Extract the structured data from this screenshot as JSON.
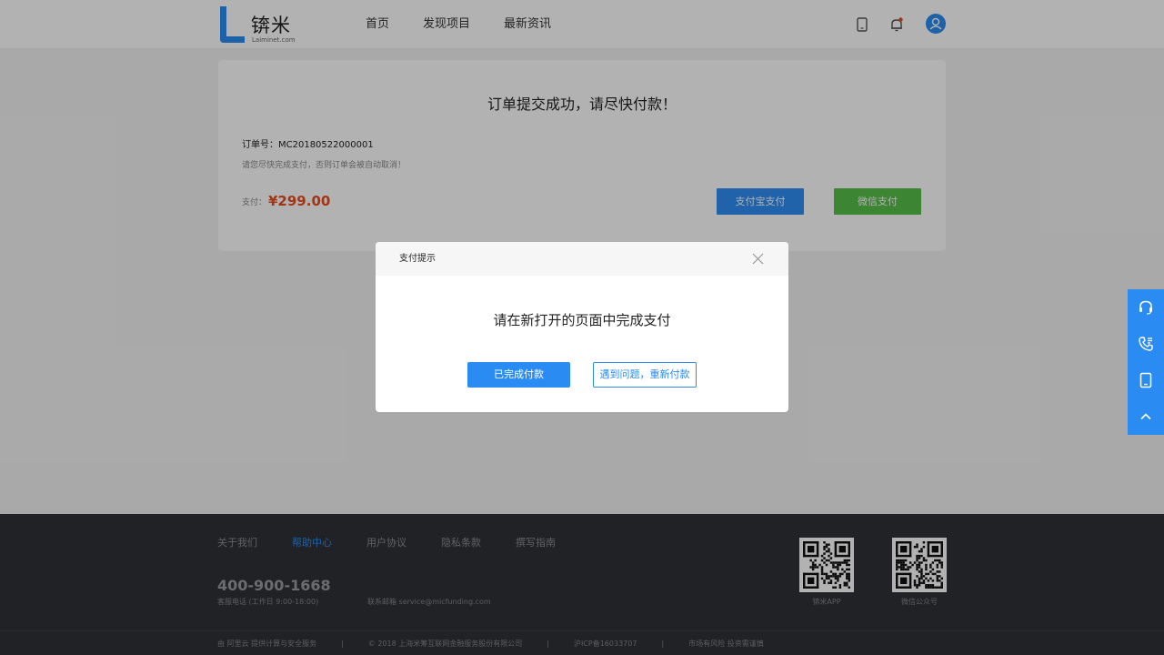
{
  "header": {
    "brand_name": "锛米",
    "brand_domain": "Laiminet.com",
    "nav": [
      {
        "label": "首页"
      },
      {
        "label": "发现项目"
      },
      {
        "label": "最新资讯"
      }
    ],
    "icons": [
      "tablet-icon",
      "bell-icon",
      "user-avatar-icon"
    ],
    "brand_color": "#2a8cf2"
  },
  "order": {
    "title": "订单提交成功，请尽快付款！",
    "order_no_label": "订单号：",
    "order_no": "MC20180522000001",
    "hint": "请您尽快完成支付，否则订单会被自动取消！",
    "pay_label": "支付：",
    "amount": "¥299.00",
    "alipay_label": "支付宝支付",
    "wechat_label": "微信支付",
    "amount_color": "#ea4c1c",
    "wechat_color": "#55bf4a"
  },
  "modal": {
    "title": "支付提示",
    "message": "请在新打开的页面中完成支付",
    "done_label": "已完成付款",
    "retry_label": "遇到问题，重新付款"
  },
  "footer": {
    "links": [
      {
        "label": "关于我们",
        "active": false
      },
      {
        "label": "帮助中心",
        "active": true
      },
      {
        "label": "用户协议",
        "active": false
      },
      {
        "label": "隐私条款",
        "active": false
      },
      {
        "label": "撰写指南",
        "active": false
      }
    ],
    "phone": "400-900-1668",
    "phone_hours": "客服电话 (工作日 9:00-18:00)",
    "email": "联系邮箱 service@micfunding.com",
    "qr": [
      {
        "caption": "锛米APP"
      },
      {
        "caption": "微信公众号"
      }
    ],
    "bottom": [
      "由 阿里云 提供计算与安全服务",
      "© 2018 上海米筹互联网金融服务股份有限公司",
      "沪ICP备16033707",
      "市场有风险  投资需谨慎"
    ],
    "separator": "|"
  },
  "side_toolbar": {
    "items": [
      "headset-icon",
      "phone-icon",
      "tablet-icon",
      "back-to-top-icon"
    ]
  }
}
